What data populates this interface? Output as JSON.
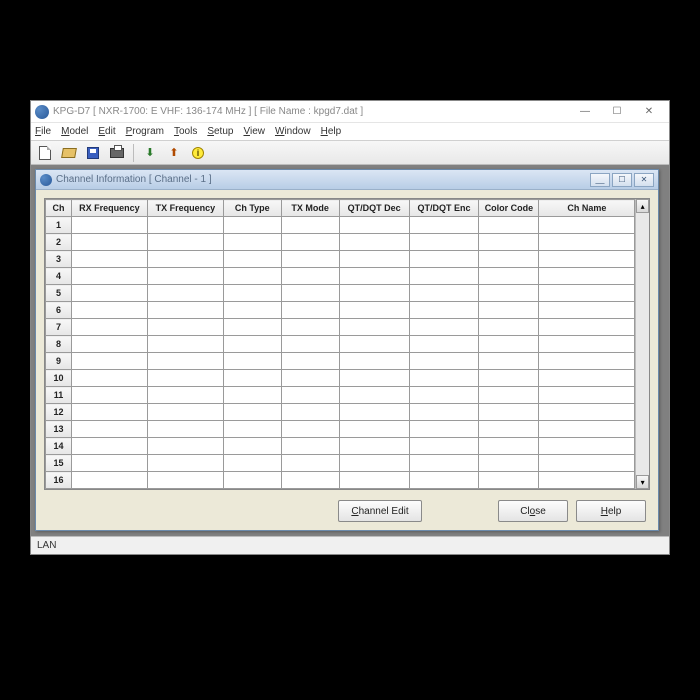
{
  "window": {
    "title": "KPG-D7   [ NXR-1700: E  VHF: 136-174 MHz ] [ File Name : kpgd7.dat ]",
    "min_tip": "Minimize",
    "max_tip": "Maximize",
    "close_tip": "Close"
  },
  "menu": {
    "file": "File",
    "model": "Model",
    "edit": "Edit",
    "program": "Program",
    "tools": "Tools",
    "setup": "Setup",
    "view": "View",
    "window": "Window",
    "help": "Help"
  },
  "toolbar": {
    "new": "New",
    "open": "Open",
    "save": "Save",
    "print": "Print",
    "read": "Read",
    "write": "Write",
    "info": "Info"
  },
  "child": {
    "title": "Channel Information [ Channel - 1 ]",
    "columns": {
      "ch": "Ch",
      "rx": "RX Frequency",
      "tx": "TX Frequency",
      "ctype": "Ch Type",
      "txmode": "TX Mode",
      "dec": "QT/DQT Dec",
      "enc": "QT/DQT Enc",
      "cc": "Color Code",
      "name": "Ch Name"
    },
    "rows": [
      {
        "n": "1",
        "rx": "",
        "tx": "",
        "ctype": "",
        "txmode": "",
        "dec": "",
        "enc": "",
        "cc": "",
        "name": ""
      },
      {
        "n": "2",
        "rx": "",
        "tx": "",
        "ctype": "",
        "txmode": "",
        "dec": "",
        "enc": "",
        "cc": "",
        "name": ""
      },
      {
        "n": "3",
        "rx": "",
        "tx": "",
        "ctype": "",
        "txmode": "",
        "dec": "",
        "enc": "",
        "cc": "",
        "name": ""
      },
      {
        "n": "4",
        "rx": "",
        "tx": "",
        "ctype": "",
        "txmode": "",
        "dec": "",
        "enc": "",
        "cc": "",
        "name": ""
      },
      {
        "n": "5",
        "rx": "",
        "tx": "",
        "ctype": "",
        "txmode": "",
        "dec": "",
        "enc": "",
        "cc": "",
        "name": ""
      },
      {
        "n": "6",
        "rx": "",
        "tx": "",
        "ctype": "",
        "txmode": "",
        "dec": "",
        "enc": "",
        "cc": "",
        "name": ""
      },
      {
        "n": "7",
        "rx": "",
        "tx": "",
        "ctype": "",
        "txmode": "",
        "dec": "",
        "enc": "",
        "cc": "",
        "name": ""
      },
      {
        "n": "8",
        "rx": "",
        "tx": "",
        "ctype": "",
        "txmode": "",
        "dec": "",
        "enc": "",
        "cc": "",
        "name": ""
      },
      {
        "n": "9",
        "rx": "",
        "tx": "",
        "ctype": "",
        "txmode": "",
        "dec": "",
        "enc": "",
        "cc": "",
        "name": ""
      },
      {
        "n": "10",
        "rx": "",
        "tx": "",
        "ctype": "",
        "txmode": "",
        "dec": "",
        "enc": "",
        "cc": "",
        "name": ""
      },
      {
        "n": "11",
        "rx": "",
        "tx": "",
        "ctype": "",
        "txmode": "",
        "dec": "",
        "enc": "",
        "cc": "",
        "name": ""
      },
      {
        "n": "12",
        "rx": "",
        "tx": "",
        "ctype": "",
        "txmode": "",
        "dec": "",
        "enc": "",
        "cc": "",
        "name": ""
      },
      {
        "n": "13",
        "rx": "",
        "tx": "",
        "ctype": "",
        "txmode": "",
        "dec": "",
        "enc": "",
        "cc": "",
        "name": ""
      },
      {
        "n": "14",
        "rx": "",
        "tx": "",
        "ctype": "",
        "txmode": "",
        "dec": "",
        "enc": "",
        "cc": "",
        "name": ""
      },
      {
        "n": "15",
        "rx": "",
        "tx": "",
        "ctype": "",
        "txmode": "",
        "dec": "",
        "enc": "",
        "cc": "",
        "name": ""
      },
      {
        "n": "16",
        "rx": "",
        "tx": "",
        "ctype": "",
        "txmode": "",
        "dec": "",
        "enc": "",
        "cc": "",
        "name": ""
      }
    ],
    "buttons": {
      "channel_edit": "Channel Edit",
      "close": "Close",
      "help": "Help"
    }
  },
  "status": {
    "text": "LAN"
  }
}
